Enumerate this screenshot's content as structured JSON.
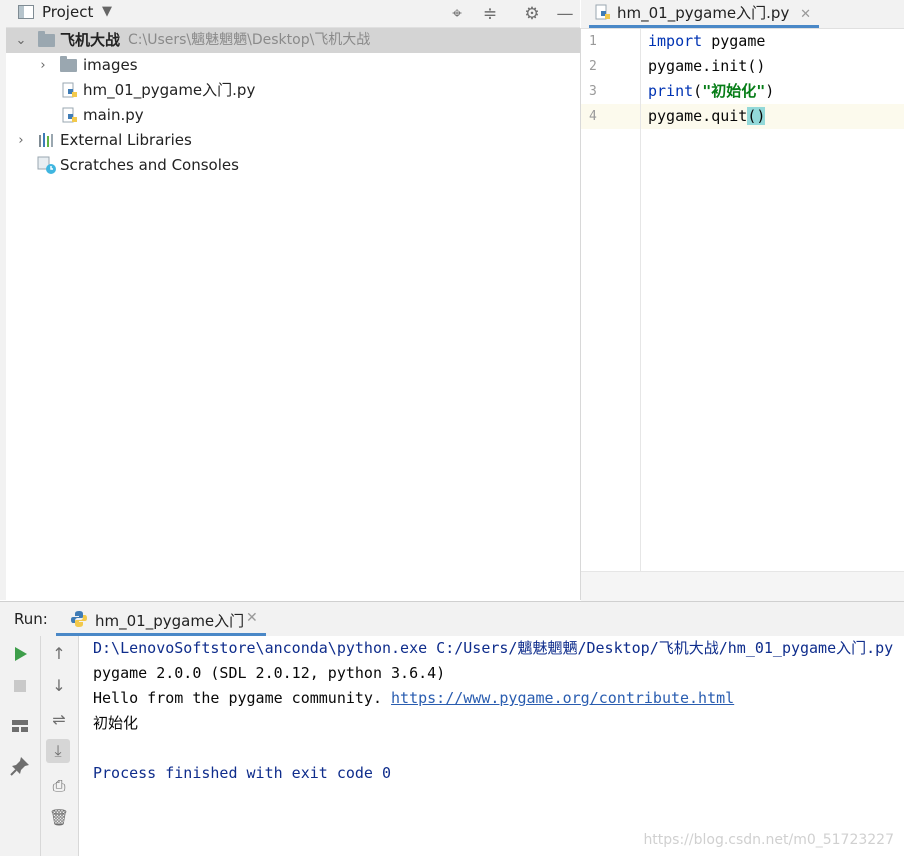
{
  "project_panel": {
    "title": "Project",
    "tree": {
      "root_name": "飞机大战",
      "root_path": "C:\\Users\\魑魅魍魉\\Desktop\\飞机大战",
      "items": [
        {
          "label": "images"
        },
        {
          "label": "hm_01_pygame入门.py"
        },
        {
          "label": "main.py"
        }
      ],
      "external_libraries": "External Libraries",
      "scratches": "Scratches and Consoles"
    }
  },
  "editor": {
    "tab_label": "hm_01_pygame入门.py",
    "line_numbers": [
      "1",
      "2",
      "3",
      "4"
    ],
    "lines": {
      "l1_kw": "import",
      "l1_rest": " pygame",
      "l2": "pygame.init()",
      "l3_kw": "print",
      "l3_open": "(",
      "l3_str": "\"初始化\"",
      "l3_close": ")",
      "l4_pre": "pygame.quit",
      "l4_hl": "()"
    }
  },
  "run_panel": {
    "label": "Run:",
    "tab_label": "hm_01_pygame入门",
    "console": {
      "line1": "D:\\LenovoSoftstore\\anconda\\python.exe C:/Users/魑魅魍魉/Desktop/飞机大战/hm_01_pygame入门.py",
      "line2": "pygame 2.0.0 (SDL 2.0.12, python 3.6.4)",
      "line3_text": "Hello from the pygame community. ",
      "line3_link": "https://www.pygame.org/contribute.html",
      "line4": "初始化",
      "line5": "Process finished with exit code 0"
    }
  },
  "watermark": "https://blog.csdn.net/m0_51723227",
  "colors": {
    "accent": "#4a88c7",
    "keyword": "#0033b3",
    "string": "#067d17",
    "run_green": "#3e9e4a"
  }
}
